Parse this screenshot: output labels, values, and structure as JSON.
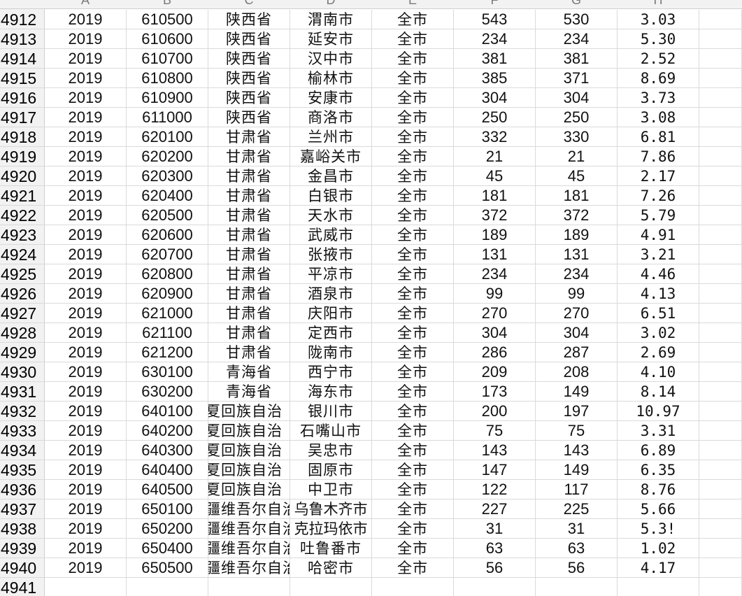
{
  "sheet": {
    "column_header_letters": [
      "A",
      "B",
      "C",
      "D",
      "E",
      "F",
      "G",
      "H"
    ],
    "rows": [
      {
        "num": "4912",
        "cells": [
          "2019",
          "610500",
          "陕西省",
          "渭南市",
          "全市",
          "543",
          "530",
          "3.03"
        ]
      },
      {
        "num": "4913",
        "cells": [
          "2019",
          "610600",
          "陕西省",
          "延安市",
          "全市",
          "234",
          "234",
          "5.30"
        ]
      },
      {
        "num": "4914",
        "cells": [
          "2019",
          "610700",
          "陕西省",
          "汉中市",
          "全市",
          "381",
          "381",
          "2.52"
        ]
      },
      {
        "num": "4915",
        "cells": [
          "2019",
          "610800",
          "陕西省",
          "榆林市",
          "全市",
          "385",
          "371",
          "8.69"
        ]
      },
      {
        "num": "4916",
        "cells": [
          "2019",
          "610900",
          "陕西省",
          "安康市",
          "全市",
          "304",
          "304",
          "3.73"
        ]
      },
      {
        "num": "4917",
        "cells": [
          "2019",
          "611000",
          "陕西省",
          "商洛市",
          "全市",
          "250",
          "250",
          "3.08"
        ]
      },
      {
        "num": "4918",
        "cells": [
          "2019",
          "620100",
          "甘肃省",
          "兰州市",
          "全市",
          "332",
          "330",
          "6.81"
        ]
      },
      {
        "num": "4919",
        "cells": [
          "2019",
          "620200",
          "甘肃省",
          "嘉峪关市",
          "全市",
          "21",
          "21",
          "7.86"
        ]
      },
      {
        "num": "4920",
        "cells": [
          "2019",
          "620300",
          "甘肃省",
          "金昌市",
          "全市",
          "45",
          "45",
          "2.17"
        ]
      },
      {
        "num": "4921",
        "cells": [
          "2019",
          "620400",
          "甘肃省",
          "白银市",
          "全市",
          "181",
          "181",
          "7.26"
        ]
      },
      {
        "num": "4922",
        "cells": [
          "2019",
          "620500",
          "甘肃省",
          "天水市",
          "全市",
          "372",
          "372",
          "5.79"
        ]
      },
      {
        "num": "4923",
        "cells": [
          "2019",
          "620600",
          "甘肃省",
          "武威市",
          "全市",
          "189",
          "189",
          "4.91"
        ]
      },
      {
        "num": "4924",
        "cells": [
          "2019",
          "620700",
          "甘肃省",
          "张掖市",
          "全市",
          "131",
          "131",
          "3.21"
        ]
      },
      {
        "num": "4925",
        "cells": [
          "2019",
          "620800",
          "甘肃省",
          "平凉市",
          "全市",
          "234",
          "234",
          "4.46"
        ]
      },
      {
        "num": "4926",
        "cells": [
          "2019",
          "620900",
          "甘肃省",
          "酒泉市",
          "全市",
          "99",
          "99",
          "4.13"
        ]
      },
      {
        "num": "4927",
        "cells": [
          "2019",
          "621000",
          "甘肃省",
          "庆阳市",
          "全市",
          "270",
          "270",
          "6.51"
        ]
      },
      {
        "num": "4928",
        "cells": [
          "2019",
          "621100",
          "甘肃省",
          "定西市",
          "全市",
          "304",
          "304",
          "3.02"
        ]
      },
      {
        "num": "4929",
        "cells": [
          "2019",
          "621200",
          "甘肃省",
          "陇南市",
          "全市",
          "286",
          "287",
          "2.69"
        ]
      },
      {
        "num": "4930",
        "cells": [
          "2019",
          "630100",
          "青海省",
          "西宁市",
          "全市",
          "209",
          "208",
          "4.10"
        ]
      },
      {
        "num": "4931",
        "cells": [
          "2019",
          "630200",
          "青海省",
          "海东市",
          "全市",
          "173",
          "149",
          "8.14"
        ]
      },
      {
        "num": "4932",
        "cells": [
          "2019",
          "640100",
          "夏回族自治",
          "银川市",
          "全市",
          "200",
          "197",
          "10.97"
        ]
      },
      {
        "num": "4933",
        "cells": [
          "2019",
          "640200",
          "夏回族自治",
          "石嘴山市",
          "全市",
          "75",
          "75",
          "3.31"
        ]
      },
      {
        "num": "4934",
        "cells": [
          "2019",
          "640300",
          "夏回族自治",
          "吴忠市",
          "全市",
          "143",
          "143",
          "6.89"
        ]
      },
      {
        "num": "4935",
        "cells": [
          "2019",
          "640400",
          "夏回族自治",
          "固原市",
          "全市",
          "147",
          "149",
          "6.35"
        ]
      },
      {
        "num": "4936",
        "cells": [
          "2019",
          "640500",
          "夏回族自治",
          "中卫市",
          "全市",
          "122",
          "117",
          "8.76"
        ]
      },
      {
        "num": "4937",
        "cells": [
          "2019",
          "650100",
          "疆维吾尔自治",
          "乌鲁木齐市",
          "全市",
          "227",
          "225",
          "5.66"
        ]
      },
      {
        "num": "4938",
        "cells": [
          "2019",
          "650200",
          "疆维吾尔自治",
          "克拉玛依市",
          "全市",
          "31",
          "31",
          "5.3!"
        ]
      },
      {
        "num": "4939",
        "cells": [
          "2019",
          "650400",
          "疆维吾尔自治",
          "吐鲁番市",
          "全市",
          "63",
          "63",
          "1.02"
        ]
      },
      {
        "num": "4940",
        "cells": [
          "2019",
          "650500",
          "疆维吾尔自治",
          "哈密市",
          "全市",
          "56",
          "56",
          "4.17"
        ]
      },
      {
        "num": "4941",
        "cells": [
          "",
          "",
          "",
          "",
          "",
          "",
          "",
          ""
        ]
      }
    ]
  }
}
